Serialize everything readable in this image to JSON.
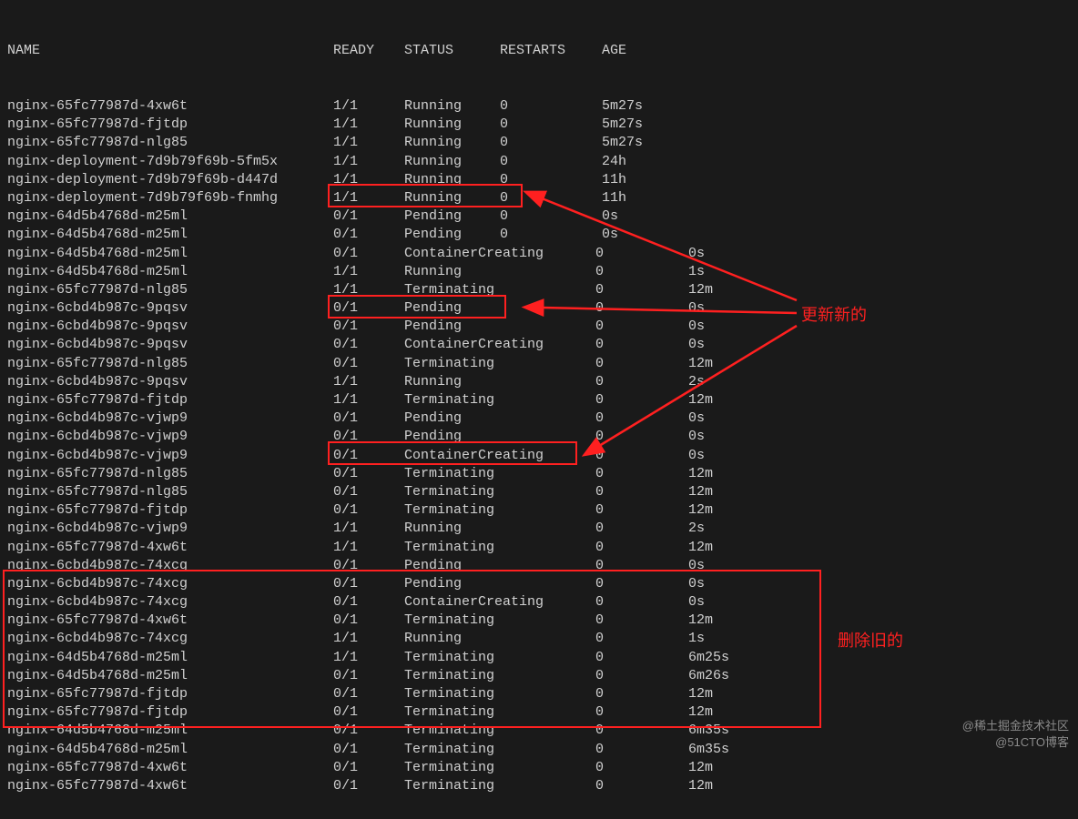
{
  "header": {
    "name": "NAME",
    "ready": "READY",
    "status": "STATUS",
    "restarts": "RESTARTS",
    "age": "AGE"
  },
  "rows": [
    {
      "name": "nginx-65fc77987d-4xw6t",
      "ready": "1/1",
      "status": "Running",
      "restarts": "0",
      "age": "5m27s",
      "wide": false
    },
    {
      "name": "nginx-65fc77987d-fjtdp",
      "ready": "1/1",
      "status": "Running",
      "restarts": "0",
      "age": "5m27s",
      "wide": false
    },
    {
      "name": "nginx-65fc77987d-nlg85",
      "ready": "1/1",
      "status": "Running",
      "restarts": "0",
      "age": "5m27s",
      "wide": false
    },
    {
      "name": "nginx-deployment-7d9b79f69b-5fm5x",
      "ready": "1/1",
      "status": "Running",
      "restarts": "0",
      "age": "24h",
      "wide": false
    },
    {
      "name": "nginx-deployment-7d9b79f69b-d447d",
      "ready": "1/1",
      "status": "Running",
      "restarts": "0",
      "age": "11h",
      "wide": false
    },
    {
      "name": "nginx-deployment-7d9b79f69b-fnmhg",
      "ready": "1/1",
      "status": "Running",
      "restarts": "0",
      "age": "11h",
      "wide": false
    },
    {
      "name": "nginx-64d5b4768d-m25ml",
      "ready": "0/1",
      "status": "Pending",
      "restarts": "0",
      "age": "0s",
      "wide": false
    },
    {
      "name": "nginx-64d5b4768d-m25ml",
      "ready": "0/1",
      "status": "Pending",
      "restarts": "0",
      "age": "0s",
      "wide": false
    },
    {
      "name": "nginx-64d5b4768d-m25ml",
      "ready": "0/1",
      "status": "ContainerCreating",
      "restarts": "0",
      "age": "0s",
      "wide": true
    },
    {
      "name": "nginx-64d5b4768d-m25ml",
      "ready": "1/1",
      "status": "Running",
      "restarts": "0",
      "age": "1s",
      "wide": true
    },
    {
      "name": "nginx-65fc77987d-nlg85",
      "ready": "1/1",
      "status": "Terminating",
      "restarts": "0",
      "age": "12m",
      "wide": true
    },
    {
      "name": "nginx-6cbd4b987c-9pqsv",
      "ready": "0/1",
      "status": "Pending",
      "restarts": "0",
      "age": "0s",
      "wide": true
    },
    {
      "name": "nginx-6cbd4b987c-9pqsv",
      "ready": "0/1",
      "status": "Pending",
      "restarts": "0",
      "age": "0s",
      "wide": true
    },
    {
      "name": "nginx-6cbd4b987c-9pqsv",
      "ready": "0/1",
      "status": "ContainerCreating",
      "restarts": "0",
      "age": "0s",
      "wide": true
    },
    {
      "name": "nginx-65fc77987d-nlg85",
      "ready": "0/1",
      "status": "Terminating",
      "restarts": "0",
      "age": "12m",
      "wide": true
    },
    {
      "name": "nginx-6cbd4b987c-9pqsv",
      "ready": "1/1",
      "status": "Running",
      "restarts": "0",
      "age": "2s",
      "wide": true
    },
    {
      "name": "nginx-65fc77987d-fjtdp",
      "ready": "1/1",
      "status": "Terminating",
      "restarts": "0",
      "age": "12m",
      "wide": true
    },
    {
      "name": "nginx-6cbd4b987c-vjwp9",
      "ready": "0/1",
      "status": "Pending",
      "restarts": "0",
      "age": "0s",
      "wide": true
    },
    {
      "name": "nginx-6cbd4b987c-vjwp9",
      "ready": "0/1",
      "status": "Pending",
      "restarts": "0",
      "age": "0s",
      "wide": true
    },
    {
      "name": "nginx-6cbd4b987c-vjwp9",
      "ready": "0/1",
      "status": "ContainerCreating",
      "restarts": "0",
      "age": "0s",
      "wide": true
    },
    {
      "name": "nginx-65fc77987d-nlg85",
      "ready": "0/1",
      "status": "Terminating",
      "restarts": "0",
      "age": "12m",
      "wide": true
    },
    {
      "name": "nginx-65fc77987d-nlg85",
      "ready": "0/1",
      "status": "Terminating",
      "restarts": "0",
      "age": "12m",
      "wide": true
    },
    {
      "name": "nginx-65fc77987d-fjtdp",
      "ready": "0/1",
      "status": "Terminating",
      "restarts": "0",
      "age": "12m",
      "wide": true
    },
    {
      "name": "nginx-6cbd4b987c-vjwp9",
      "ready": "1/1",
      "status": "Running",
      "restarts": "0",
      "age": "2s",
      "wide": true
    },
    {
      "name": "nginx-65fc77987d-4xw6t",
      "ready": "1/1",
      "status": "Terminating",
      "restarts": "0",
      "age": "12m",
      "wide": true
    },
    {
      "name": "nginx-6cbd4b987c-74xcg",
      "ready": "0/1",
      "status": "Pending",
      "restarts": "0",
      "age": "0s",
      "wide": true
    },
    {
      "name": "nginx-6cbd4b987c-74xcg",
      "ready": "0/1",
      "status": "Pending",
      "restarts": "0",
      "age": "0s",
      "wide": true
    },
    {
      "name": "nginx-6cbd4b987c-74xcg",
      "ready": "0/1",
      "status": "ContainerCreating",
      "restarts": "0",
      "age": "0s",
      "wide": true
    },
    {
      "name": "nginx-65fc77987d-4xw6t",
      "ready": "0/1",
      "status": "Terminating",
      "restarts": "0",
      "age": "12m",
      "wide": true
    },
    {
      "name": "nginx-6cbd4b987c-74xcg",
      "ready": "1/1",
      "status": "Running",
      "restarts": "0",
      "age": "1s",
      "wide": true
    },
    {
      "name": "nginx-64d5b4768d-m25ml",
      "ready": "1/1",
      "status": "Terminating",
      "restarts": "0",
      "age": "6m25s",
      "wide": true
    },
    {
      "name": "nginx-64d5b4768d-m25ml",
      "ready": "0/1",
      "status": "Terminating",
      "restarts": "0",
      "age": "6m26s",
      "wide": true
    },
    {
      "name": "nginx-65fc77987d-fjtdp",
      "ready": "0/1",
      "status": "Terminating",
      "restarts": "0",
      "age": "12m",
      "wide": true
    },
    {
      "name": "nginx-65fc77987d-fjtdp",
      "ready": "0/1",
      "status": "Terminating",
      "restarts": "0",
      "age": "12m",
      "wide": true
    },
    {
      "name": "nginx-64d5b4768d-m25ml",
      "ready": "0/1",
      "status": "Terminating",
      "restarts": "0",
      "age": "6m35s",
      "wide": true
    },
    {
      "name": "nginx-64d5b4768d-m25ml",
      "ready": "0/1",
      "status": "Terminating",
      "restarts": "0",
      "age": "6m35s",
      "wide": true
    },
    {
      "name": "nginx-65fc77987d-4xw6t",
      "ready": "0/1",
      "status": "Terminating",
      "restarts": "0",
      "age": "12m",
      "wide": true
    },
    {
      "name": "nginx-65fc77987d-4xw6t",
      "ready": "0/1",
      "status": "Terminating",
      "restarts": "0",
      "age": "12m",
      "wide": true
    }
  ],
  "annotations": {
    "update_new": "更新新的",
    "delete_old": "删除旧的"
  },
  "watermark": {
    "line1": "@稀土掘金技术社区",
    "line2": "@51CTO博客"
  }
}
